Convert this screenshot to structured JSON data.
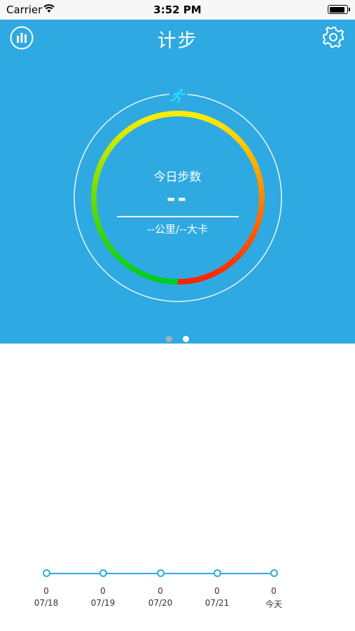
{
  "status_bar": {
    "carrier": "Carrier",
    "time": "3:52 PM",
    "battery_level": 0.9
  },
  "header": {
    "title": "计步",
    "stats_icon": "bar-chart-icon",
    "settings_icon": "gear-icon"
  },
  "ring": {
    "label": "今日步数",
    "steps": "--",
    "sub": "--公里/--大卡",
    "runner_icon": "runner-icon",
    "gradient_colors": [
      "#ff2200",
      "#ff7a00",
      "#ffee00",
      "#66dd00",
      "#00cc22"
    ]
  },
  "pager": {
    "pages": 2,
    "current": 2
  },
  "colors": {
    "accent": "#2fa9e1"
  },
  "timeline": {
    "days": [
      {
        "value": "0",
        "date": "07/18"
      },
      {
        "value": "0",
        "date": "07/19"
      },
      {
        "value": "0",
        "date": "07/20"
      },
      {
        "value": "0",
        "date": "07/21"
      },
      {
        "value": "0",
        "date": "今天"
      }
    ]
  }
}
